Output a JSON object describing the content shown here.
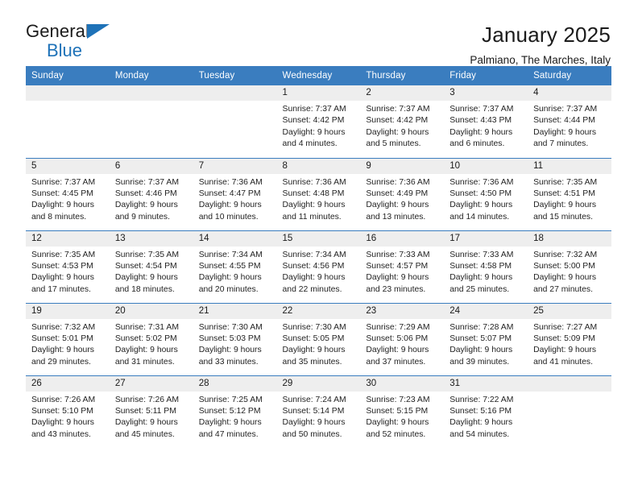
{
  "brand": {
    "name_part1": "General",
    "name_part2": "Blue",
    "accent_color": "#1e72b8"
  },
  "header": {
    "title": "January 2025",
    "subtitle": "Palmiano, The Marches, Italy"
  },
  "theme": {
    "header_row_bg": "#3a7dbf",
    "daynum_bg": "#eeeeee",
    "row_divider": "#3a7dbf"
  },
  "columns": [
    "Sunday",
    "Monday",
    "Tuesday",
    "Wednesday",
    "Thursday",
    "Friday",
    "Saturday"
  ],
  "labels": {
    "sunrise_prefix": "Sunrise:",
    "sunset_prefix": "Sunset:",
    "daylight_prefix": "Daylight:"
  },
  "weeks": [
    [
      {
        "day": "",
        "empty": true
      },
      {
        "day": "",
        "empty": true
      },
      {
        "day": "",
        "empty": true
      },
      {
        "day": "1",
        "sunrise": "Sunrise: 7:37 AM",
        "sunset": "Sunset: 4:42 PM",
        "daylight1": "Daylight: 9 hours",
        "daylight2": "and 4 minutes."
      },
      {
        "day": "2",
        "sunrise": "Sunrise: 7:37 AM",
        "sunset": "Sunset: 4:42 PM",
        "daylight1": "Daylight: 9 hours",
        "daylight2": "and 5 minutes."
      },
      {
        "day": "3",
        "sunrise": "Sunrise: 7:37 AM",
        "sunset": "Sunset: 4:43 PM",
        "daylight1": "Daylight: 9 hours",
        "daylight2": "and 6 minutes."
      },
      {
        "day": "4",
        "sunrise": "Sunrise: 7:37 AM",
        "sunset": "Sunset: 4:44 PM",
        "daylight1": "Daylight: 9 hours",
        "daylight2": "and 7 minutes."
      }
    ],
    [
      {
        "day": "5",
        "sunrise": "Sunrise: 7:37 AM",
        "sunset": "Sunset: 4:45 PM",
        "daylight1": "Daylight: 9 hours",
        "daylight2": "and 8 minutes."
      },
      {
        "day": "6",
        "sunrise": "Sunrise: 7:37 AM",
        "sunset": "Sunset: 4:46 PM",
        "daylight1": "Daylight: 9 hours",
        "daylight2": "and 9 minutes."
      },
      {
        "day": "7",
        "sunrise": "Sunrise: 7:36 AM",
        "sunset": "Sunset: 4:47 PM",
        "daylight1": "Daylight: 9 hours",
        "daylight2": "and 10 minutes."
      },
      {
        "day": "8",
        "sunrise": "Sunrise: 7:36 AM",
        "sunset": "Sunset: 4:48 PM",
        "daylight1": "Daylight: 9 hours",
        "daylight2": "and 11 minutes."
      },
      {
        "day": "9",
        "sunrise": "Sunrise: 7:36 AM",
        "sunset": "Sunset: 4:49 PM",
        "daylight1": "Daylight: 9 hours",
        "daylight2": "and 13 minutes."
      },
      {
        "day": "10",
        "sunrise": "Sunrise: 7:36 AM",
        "sunset": "Sunset: 4:50 PM",
        "daylight1": "Daylight: 9 hours",
        "daylight2": "and 14 minutes."
      },
      {
        "day": "11",
        "sunrise": "Sunrise: 7:35 AM",
        "sunset": "Sunset: 4:51 PM",
        "daylight1": "Daylight: 9 hours",
        "daylight2": "and 15 minutes."
      }
    ],
    [
      {
        "day": "12",
        "sunrise": "Sunrise: 7:35 AM",
        "sunset": "Sunset: 4:53 PM",
        "daylight1": "Daylight: 9 hours",
        "daylight2": "and 17 minutes."
      },
      {
        "day": "13",
        "sunrise": "Sunrise: 7:35 AM",
        "sunset": "Sunset: 4:54 PM",
        "daylight1": "Daylight: 9 hours",
        "daylight2": "and 18 minutes."
      },
      {
        "day": "14",
        "sunrise": "Sunrise: 7:34 AM",
        "sunset": "Sunset: 4:55 PM",
        "daylight1": "Daylight: 9 hours",
        "daylight2": "and 20 minutes."
      },
      {
        "day": "15",
        "sunrise": "Sunrise: 7:34 AM",
        "sunset": "Sunset: 4:56 PM",
        "daylight1": "Daylight: 9 hours",
        "daylight2": "and 22 minutes."
      },
      {
        "day": "16",
        "sunrise": "Sunrise: 7:33 AM",
        "sunset": "Sunset: 4:57 PM",
        "daylight1": "Daylight: 9 hours",
        "daylight2": "and 23 minutes."
      },
      {
        "day": "17",
        "sunrise": "Sunrise: 7:33 AM",
        "sunset": "Sunset: 4:58 PM",
        "daylight1": "Daylight: 9 hours",
        "daylight2": "and 25 minutes."
      },
      {
        "day": "18",
        "sunrise": "Sunrise: 7:32 AM",
        "sunset": "Sunset: 5:00 PM",
        "daylight1": "Daylight: 9 hours",
        "daylight2": "and 27 minutes."
      }
    ],
    [
      {
        "day": "19",
        "sunrise": "Sunrise: 7:32 AM",
        "sunset": "Sunset: 5:01 PM",
        "daylight1": "Daylight: 9 hours",
        "daylight2": "and 29 minutes."
      },
      {
        "day": "20",
        "sunrise": "Sunrise: 7:31 AM",
        "sunset": "Sunset: 5:02 PM",
        "daylight1": "Daylight: 9 hours",
        "daylight2": "and 31 minutes."
      },
      {
        "day": "21",
        "sunrise": "Sunrise: 7:30 AM",
        "sunset": "Sunset: 5:03 PM",
        "daylight1": "Daylight: 9 hours",
        "daylight2": "and 33 minutes."
      },
      {
        "day": "22",
        "sunrise": "Sunrise: 7:30 AM",
        "sunset": "Sunset: 5:05 PM",
        "daylight1": "Daylight: 9 hours",
        "daylight2": "and 35 minutes."
      },
      {
        "day": "23",
        "sunrise": "Sunrise: 7:29 AM",
        "sunset": "Sunset: 5:06 PM",
        "daylight1": "Daylight: 9 hours",
        "daylight2": "and 37 minutes."
      },
      {
        "day": "24",
        "sunrise": "Sunrise: 7:28 AM",
        "sunset": "Sunset: 5:07 PM",
        "daylight1": "Daylight: 9 hours",
        "daylight2": "and 39 minutes."
      },
      {
        "day": "25",
        "sunrise": "Sunrise: 7:27 AM",
        "sunset": "Sunset: 5:09 PM",
        "daylight1": "Daylight: 9 hours",
        "daylight2": "and 41 minutes."
      }
    ],
    [
      {
        "day": "26",
        "sunrise": "Sunrise: 7:26 AM",
        "sunset": "Sunset: 5:10 PM",
        "daylight1": "Daylight: 9 hours",
        "daylight2": "and 43 minutes."
      },
      {
        "day": "27",
        "sunrise": "Sunrise: 7:26 AM",
        "sunset": "Sunset: 5:11 PM",
        "daylight1": "Daylight: 9 hours",
        "daylight2": "and 45 minutes."
      },
      {
        "day": "28",
        "sunrise": "Sunrise: 7:25 AM",
        "sunset": "Sunset: 5:12 PM",
        "daylight1": "Daylight: 9 hours",
        "daylight2": "and 47 minutes."
      },
      {
        "day": "29",
        "sunrise": "Sunrise: 7:24 AM",
        "sunset": "Sunset: 5:14 PM",
        "daylight1": "Daylight: 9 hours",
        "daylight2": "and 50 minutes."
      },
      {
        "day": "30",
        "sunrise": "Sunrise: 7:23 AM",
        "sunset": "Sunset: 5:15 PM",
        "daylight1": "Daylight: 9 hours",
        "daylight2": "and 52 minutes."
      },
      {
        "day": "31",
        "sunrise": "Sunrise: 7:22 AM",
        "sunset": "Sunset: 5:16 PM",
        "daylight1": "Daylight: 9 hours",
        "daylight2": "and 54 minutes."
      },
      {
        "day": "",
        "empty": true
      }
    ]
  ]
}
